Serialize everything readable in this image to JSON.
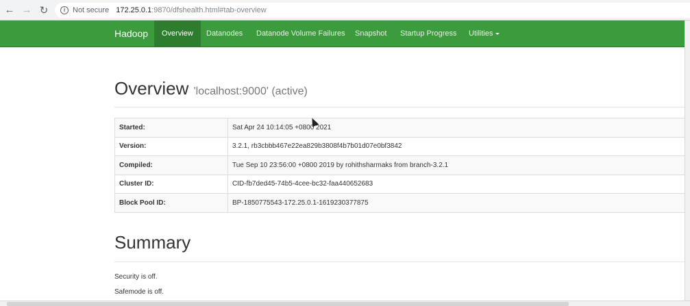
{
  "browser": {
    "back_icon": "←",
    "forward_icon": "→",
    "reload_icon": "↻",
    "info_icon": "i",
    "security_label": "Not secure",
    "url_host": "172.25.0.1",
    "url_rest": ":9870/dfshealth.html#tab-overview"
  },
  "navbar": {
    "brand": "Hadoop",
    "items": [
      {
        "label": "Overview"
      },
      {
        "label": "Datanodes"
      },
      {
        "label": "Datanode Volume Failures"
      },
      {
        "label": "Snapshot"
      },
      {
        "label": "Startup Progress"
      },
      {
        "label": "Utilities"
      }
    ],
    "active_index": 0,
    "color": "#3c9b3c"
  },
  "overview": {
    "title": "Overview",
    "subtitle": "'localhost:9000' (active)",
    "rows": [
      {
        "label": "Started:",
        "value": "Sat Apr 24 10:14:05 +0800 2021"
      },
      {
        "label": "Version:",
        "value": "3.2.1, rb3cbbb467e22ea829b3808f4b7b01d07e0bf3842"
      },
      {
        "label": "Compiled:",
        "value": "Tue Sep 10 23:56:00 +0800 2019 by rohithsharmaks from branch-3.2.1"
      },
      {
        "label": "Cluster ID:",
        "value": "CID-fb7ded45-74b5-4cee-bc32-faa440652683"
      },
      {
        "label": "Block Pool ID:",
        "value": "BP-1850775543-172.25.0.1-1619230377875"
      }
    ]
  },
  "summary": {
    "title": "Summary",
    "security": "Security is off.",
    "safemode": "Safemode is off."
  }
}
